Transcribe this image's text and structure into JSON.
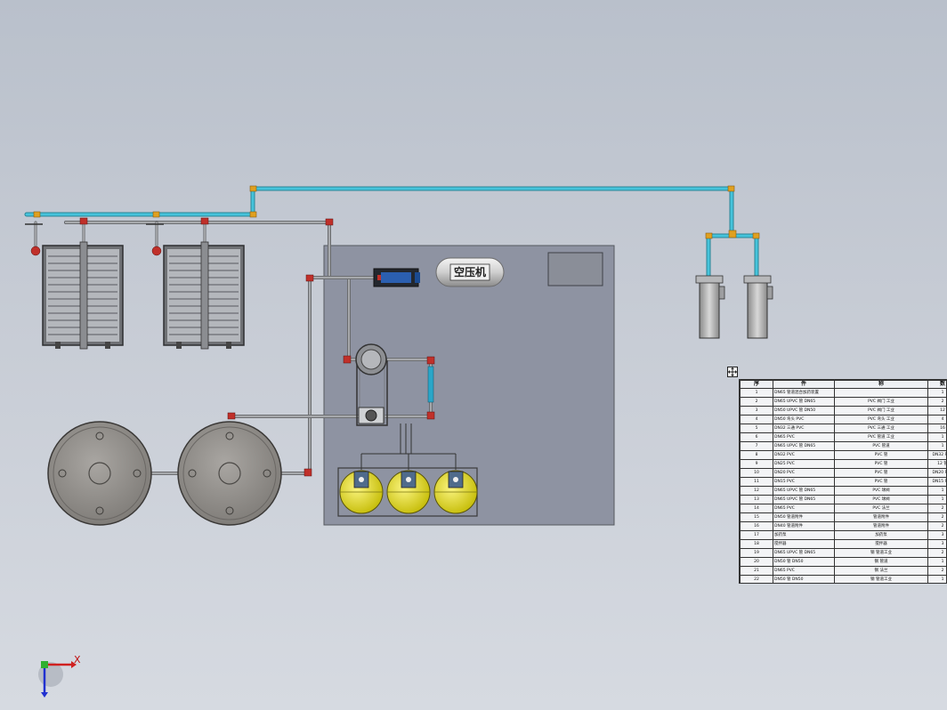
{
  "labels": {
    "tank": "空压机",
    "axis_x": "X",
    "axis_y": "Y"
  },
  "colors": {
    "background": "#c3c8d1",
    "panel": "#8e93a2",
    "water_pipe": "#35b4cc",
    "grey_pipe": "#8f9194",
    "valve": "#c0302a",
    "chemical_tank": "#e6df1c",
    "elbow": "#e0a020"
  },
  "bom": {
    "headers": [
      "序",
      "件",
      "称",
      "数"
    ],
    "rows": [
      [
        "1",
        "DN65 管道混合加药装置",
        "",
        "1"
      ],
      [
        "2",
        "DN65 UPVC 管 DN65",
        "PVC 阀门 工业",
        "2"
      ],
      [
        "3",
        "DN50 UPVC 管 DN50",
        "PVC 阀门 工业",
        "12"
      ],
      [
        "4",
        "DN50 弯头 PVC",
        "PVC 弯头 工业",
        "4"
      ],
      [
        "5",
        "DN32 三通 PVC",
        "PVC 三通 工业",
        "16"
      ],
      [
        "6",
        "DN65 PVC",
        "PVC 管道 工业",
        "1"
      ],
      [
        "7",
        "DN65 UPVC 管 DN65",
        "PVC 管道",
        "1"
      ],
      [
        "8",
        "DN32 PVC",
        "PVC 管",
        "DN32 PVC"
      ],
      [
        "9",
        "DN25 PVC",
        "PVC 管",
        "12 管"
      ],
      [
        "10",
        "DN20 PVC",
        "PVC 管",
        "DN20 PVC"
      ],
      [
        "11",
        "DN15 PVC",
        "PVC 管",
        "DN15 PVC"
      ],
      [
        "12",
        "DN65 UPVC 管 DN65",
        "PVC 球阀",
        "1"
      ],
      [
        "13",
        "DN65 UPVC 管 DN65",
        "PVC 球阀",
        "1"
      ],
      [
        "14",
        "DN65 PVC",
        "PVC 法兰",
        "2"
      ],
      [
        "15",
        "DN50 管道附件",
        "管道附件",
        "2"
      ],
      [
        "16",
        "DN40 管道附件",
        "管道附件",
        "2"
      ],
      [
        "17",
        "加药泵",
        "加药泵",
        "3"
      ],
      [
        "18",
        "搅拌器",
        "搅拌器",
        "3"
      ],
      [
        "19",
        "DN65 UPVC 管 DN65",
        "钢 管道工业",
        "2"
      ],
      [
        "20",
        "DN50 管 DN50",
        "钢 管道",
        "1"
      ],
      [
        "21",
        "DN65 PVC",
        "钢 法兰",
        "2"
      ],
      [
        "22",
        "DN50 管 DN50",
        "钢 管道工业",
        "1"
      ]
    ]
  }
}
